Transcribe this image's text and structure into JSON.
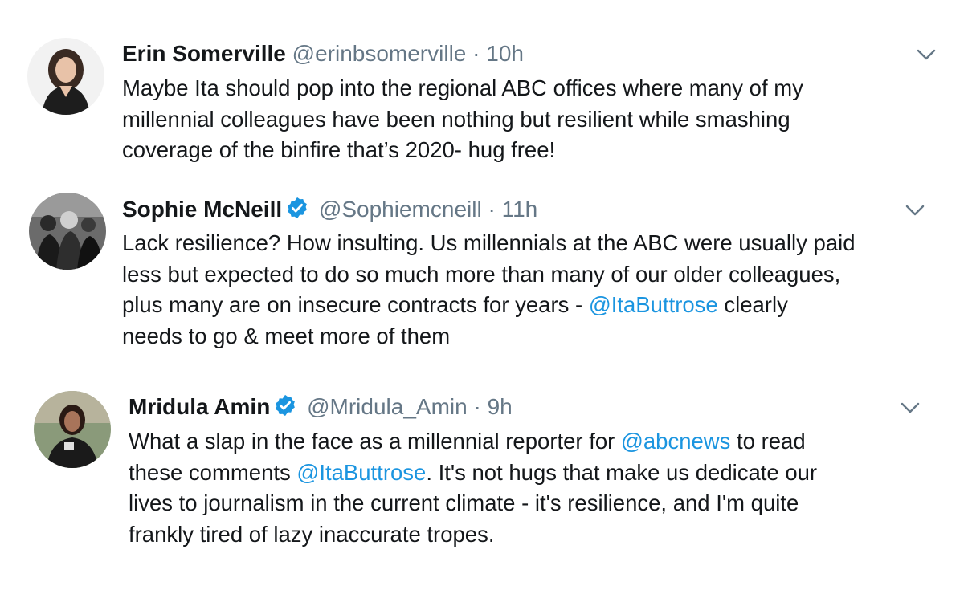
{
  "accent_color": "#1b95e0",
  "tweets": [
    {
      "name": "Erin Somerville",
      "handle": "@erinbsomerville",
      "separator": "·",
      "time": "10h",
      "verified": false,
      "lines": [
        "Maybe Ita should pop into the regional ABC offices where many of my",
        "millennial colleagues have been nothing but resilient while smashing",
        "coverage of the binfire that’s 2020- hug free!"
      ]
    },
    {
      "name": "Sophie McNeill",
      "handle": "@Sophiemcneill",
      "separator": "·",
      "time": "11h",
      "verified": true,
      "lines": [
        "Lack resilience? How insulting. Us millennials at the ABC were usually paid",
        "less but expected to do so much more than many of our older colleagues,",
        "plus many are on insecure contracts for years - ",
        "needs to go & meet more of them"
      ],
      "mention": "@ItaButtrose",
      "after_mention": " clearly"
    },
    {
      "name": "Mridula Amin",
      "handle": "@Mridula_Amin",
      "separator": "·",
      "time": "9h",
      "verified": true,
      "line1_pre": "What a slap in the face as a millennial reporter for ",
      "line1_mention": "@abcnews",
      "line1_post": " to read",
      "line2_pre": "these comments ",
      "line2_mention": "@ItaButtrose",
      "line2_post": ". It's not hugs that make us dedicate our",
      "line3": "lives to journalism in the current climate - it's resilience, and I'm quite",
      "line4": "frankly tired of lazy inaccurate tropes."
    }
  ],
  "icons": {
    "more": "chevron-down-icon",
    "verified": "verified-badge-icon"
  }
}
